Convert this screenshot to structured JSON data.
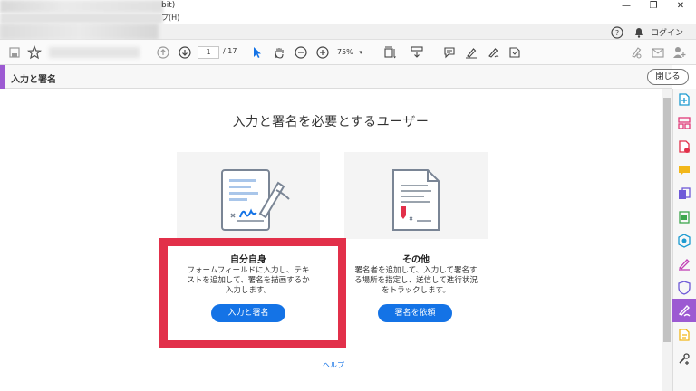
{
  "window": {
    "title_suffix": "bit)",
    "menu_help": "プ(H)",
    "minimize": "—",
    "maximize": "❐",
    "close": "✕"
  },
  "header": {
    "login_label": "ログイン"
  },
  "toolbar": {
    "page_current": "1",
    "page_total": "/ 17",
    "zoom_value": "75%"
  },
  "panel": {
    "title": "入力と署名",
    "close_label": "閉じる"
  },
  "main": {
    "heading": "入力と署名を必要とするユーザー",
    "cards": [
      {
        "title": "自分自身",
        "description": "フォームフィールドに入力し、テキストを追加して、署名を描画するか入力します。",
        "button": "入力と署名"
      },
      {
        "title": "その他",
        "description": "署名者を追加して、入力して署名する場所を指定し、送信して進行状況をトラックします。",
        "button": "署名を依頼"
      }
    ],
    "help_link": "ヘルプ"
  },
  "colors": {
    "accent": "#9c5ad2",
    "primary_button": "#1473e6",
    "highlight": "#e2304a"
  }
}
